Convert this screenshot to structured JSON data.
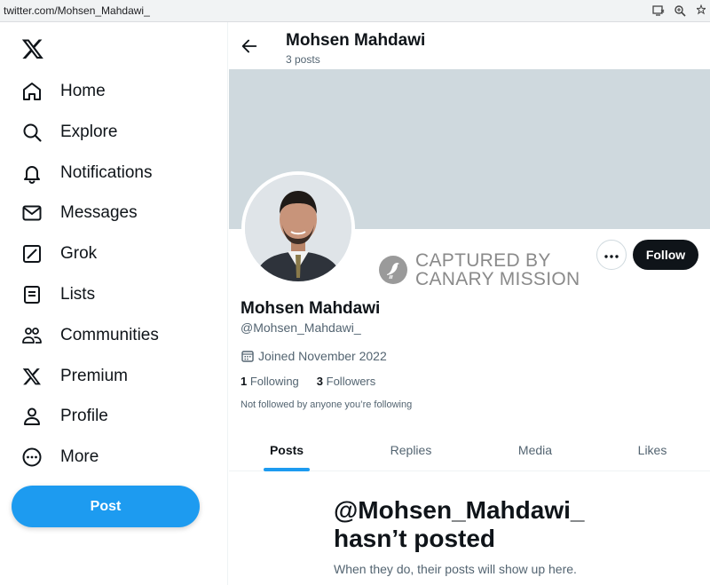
{
  "browser": {
    "url": "twitter.com/Mohsen_Mahdawi_"
  },
  "sidebar": {
    "logo": "x-logo-icon",
    "items": [
      {
        "label": "Home",
        "icon": "home-icon"
      },
      {
        "label": "Explore",
        "icon": "search-icon"
      },
      {
        "label": "Notifications",
        "icon": "bell-icon"
      },
      {
        "label": "Messages",
        "icon": "envelope-icon"
      },
      {
        "label": "Grok",
        "icon": "grok-icon"
      },
      {
        "label": "Lists",
        "icon": "list-icon"
      },
      {
        "label": "Communities",
        "icon": "communities-icon"
      },
      {
        "label": "Premium",
        "icon": "x-logo-icon"
      },
      {
        "label": "Profile",
        "icon": "person-icon"
      },
      {
        "label": "More",
        "icon": "more-circle-icon"
      }
    ],
    "post_label": "Post"
  },
  "header": {
    "name": "Mohsen Mahdawi",
    "post_count": "3 posts"
  },
  "watermark": {
    "line1": "CAPTURED BY",
    "line2": "CANARY MISSION"
  },
  "profile": {
    "follow_label": "Follow",
    "name": "Mohsen Mahdawi",
    "handle": "@Mohsen_Mahdawi_",
    "joined": "Joined November 2022",
    "following_count": "1",
    "following_label": "Following",
    "followers_count": "3",
    "followers_label": "Followers",
    "note": "Not followed by anyone you’re following"
  },
  "tabs": [
    {
      "label": "Posts",
      "active": true
    },
    {
      "label": "Replies",
      "active": false
    },
    {
      "label": "Media",
      "active": false
    },
    {
      "label": "Likes",
      "active": false
    }
  ],
  "empty": {
    "title_line1": "@Mohsen_Mahdawi_",
    "title_line2": "hasn’t posted",
    "subtitle": "When they do, their posts will show up here."
  },
  "colors": {
    "accent": "#1d9bf0",
    "banner": "#cfd9de",
    "text": "#0f1419",
    "muted": "#536471"
  }
}
